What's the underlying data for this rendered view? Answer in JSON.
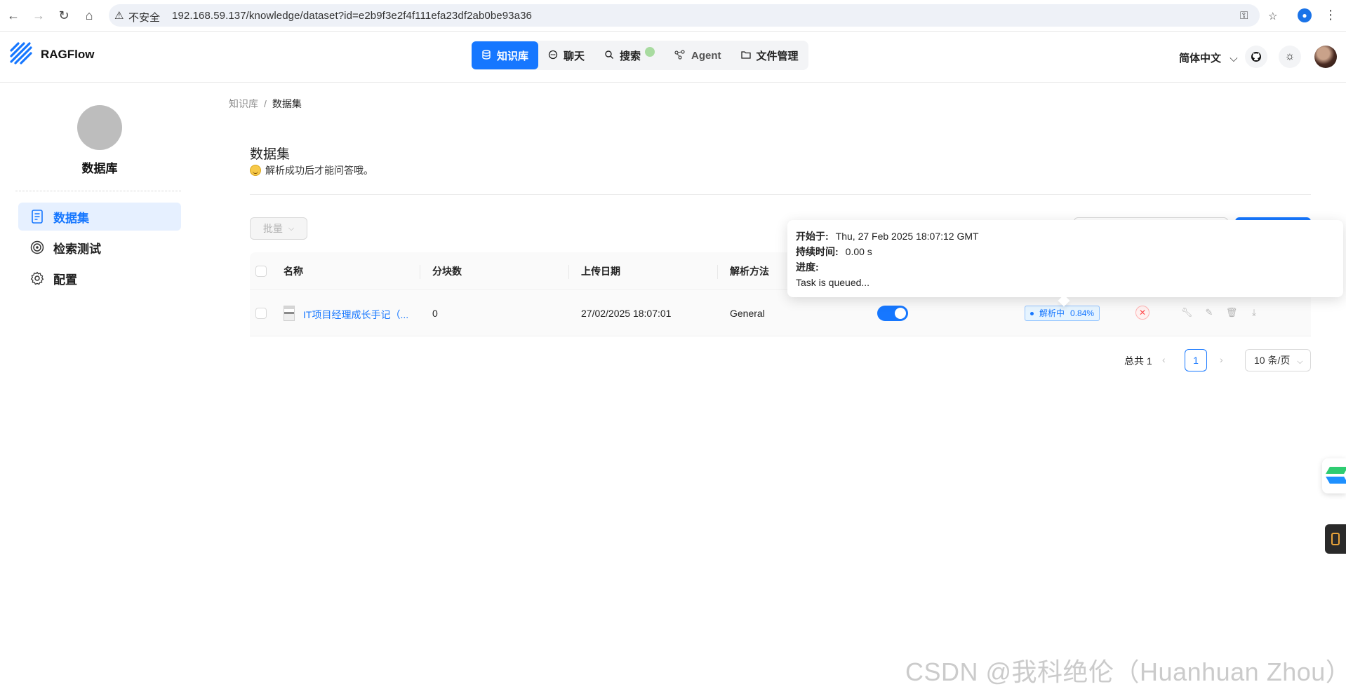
{
  "browser": {
    "insecure_label": "不安全",
    "url": "192.168.59.137/knowledge/dataset?id=e2b9f3e2f4f111efa23df2ab0be93a36"
  },
  "app": {
    "name": "RAGFlow",
    "nav": [
      {
        "label": "知识库",
        "icon": "database-icon",
        "active": true
      },
      {
        "label": "聊天",
        "icon": "chat-icon",
        "active": false
      },
      {
        "label": "搜索",
        "icon": "search-icon",
        "active": false
      },
      {
        "label": "Agent",
        "icon": "agent-graph-icon",
        "active": false
      },
      {
        "label": "文件管理",
        "icon": "folder-icon",
        "active": false
      }
    ],
    "language": "简体中文"
  },
  "sidebar": {
    "kb_name": "数据库",
    "items": [
      {
        "label": "数据集",
        "icon": "document-icon",
        "active": true
      },
      {
        "label": "检索测试",
        "icon": "target-icon",
        "active": false
      },
      {
        "label": "配置",
        "icon": "gear-icon",
        "active": false
      }
    ]
  },
  "breadcrumb": {
    "parent": "知识库",
    "sep": "/",
    "current": "数据集"
  },
  "page": {
    "title": "数据集",
    "subtitle": "解析成功后才能问答哦。",
    "bulk_label": "批量"
  },
  "table": {
    "columns": [
      "名称",
      "分块数",
      "上传日期",
      "解析方法"
    ],
    "rows": [
      {
        "name": "IT项目经理成长手记（...",
        "chunks": "0",
        "upload_date": "27/02/2025 18:07:01",
        "method": "General",
        "enabled": true,
        "status": "解析中",
        "progress": "0.84%"
      }
    ]
  },
  "pagination": {
    "total": "总共 1",
    "current_page": "1",
    "page_size": "10 条/页"
  },
  "tooltip": {
    "start_label": "开始于:",
    "start_value": "Thu, 27 Feb 2025 18:07:12 GMT",
    "duration_label": "持续时间:",
    "duration_value": "0.00 s",
    "progress_label": "进度:",
    "message": "Task is queued..."
  },
  "watermark": "CSDN @我科绝伦（Huanhuan Zhou）",
  "colors": {
    "accent": "#1677ff",
    "danger": "#ff4d4f"
  }
}
